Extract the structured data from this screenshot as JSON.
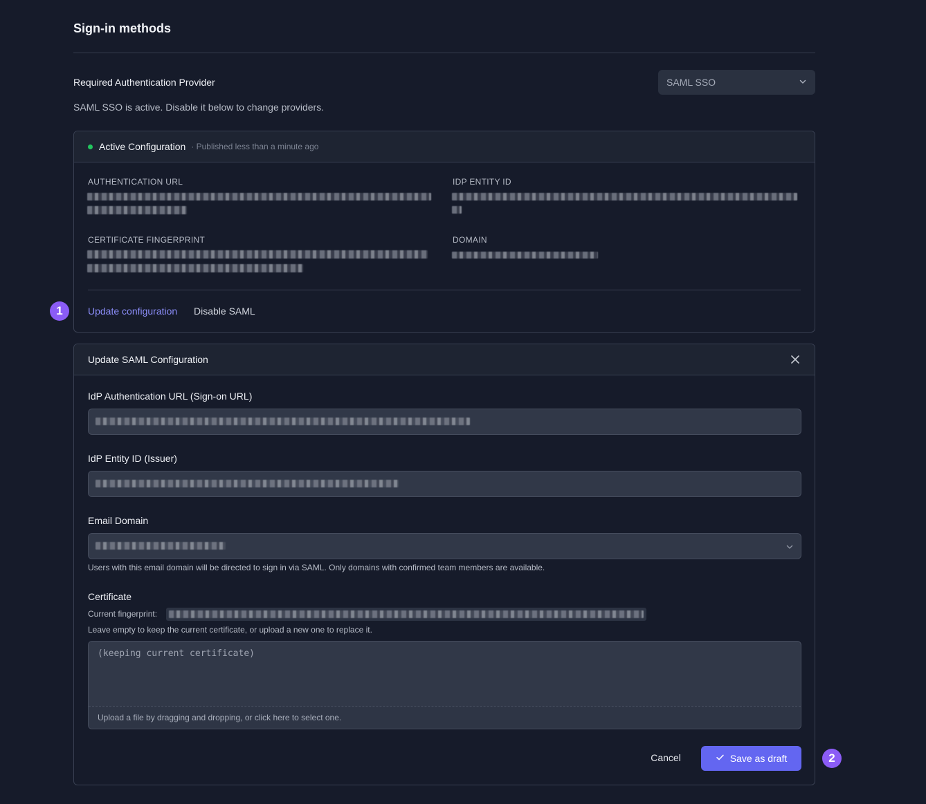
{
  "page": {
    "title": "Sign-in methods"
  },
  "provider": {
    "label": "Required Authentication Provider",
    "selected": "SAML SSO",
    "help": "SAML SSO is active. Disable it below to change providers."
  },
  "active_config": {
    "title": "Active Configuration",
    "published": "· Published less than a minute ago",
    "status_color": "#22c55e",
    "fields": {
      "auth_url_label": "AUTHENTICATION URL",
      "idp_entity_label": "IDP ENTITY ID",
      "cert_fp_label": "CERTIFICATE FINGERPRINT",
      "domain_label": "DOMAIN"
    },
    "update_link": "Update configuration",
    "disable_link": "Disable SAML"
  },
  "update_form": {
    "title": "Update SAML Configuration",
    "auth_url_label": "IdP Authentication URL (Sign-on URL)",
    "entity_label": "IdP Entity ID (Issuer)",
    "email_domain_label": "Email Domain",
    "email_domain_help": "Users with this email domain will be directed to sign in via SAML. Only domains with confirmed team members are available.",
    "certificate_label": "Certificate",
    "current_fp_label": "Current fingerprint:",
    "cert_help": "Leave empty to keep the current certificate, or upload a new one to replace it.",
    "cert_placeholder": "(keeping current certificate)",
    "upload_text": "Upload a file by dragging and dropping, or click here to select one.",
    "cancel": "Cancel",
    "save": "Save as draft"
  },
  "badges": {
    "one": "1",
    "two": "2",
    "color": "#8b5cf6"
  },
  "colors": {
    "accent": "#6366f1",
    "link": "#8b8df8",
    "background": "#161b2a"
  }
}
